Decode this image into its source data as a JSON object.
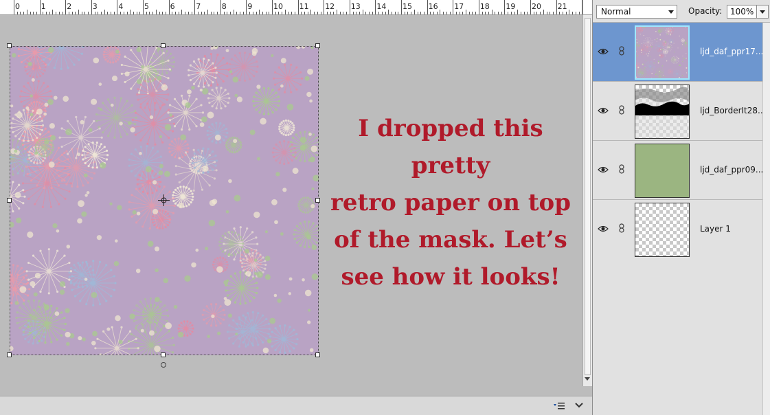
{
  "ruler": {
    "labels": [
      "0",
      "1",
      "2",
      "3",
      "4",
      "5",
      "6",
      "7",
      "8",
      "9",
      "10",
      "11",
      "12",
      "13",
      "14",
      "15",
      "16",
      "17",
      "18",
      "19",
      "20",
      "21",
      "2"
    ]
  },
  "caption": {
    "text": "I dropped this pretty\nretro paper on top\nof the mask. Let’s\nsee how it looks!",
    "color": "#b01a2a"
  },
  "layers_panel": {
    "blend_mode": "Normal",
    "opacity_label": "Opacity:",
    "opacity_value": "100%",
    "layers": [
      {
        "name": "ljd_daf_ppr17....",
        "selected": true,
        "thumb": "floral-paper"
      },
      {
        "name": "ljd_BorderIt28...",
        "selected": false,
        "thumb": "border-mask"
      },
      {
        "name": "ljd_daf_ppr09....",
        "selected": false,
        "thumb": "green-paper"
      },
      {
        "name": "Layer 1",
        "selected": false,
        "thumb": "transparent"
      }
    ]
  },
  "colors": {
    "paper_base": "#b9a3c4",
    "selection": "#6d96cf",
    "caption": "#b01a2a",
    "green_paper": "#9bb581"
  }
}
